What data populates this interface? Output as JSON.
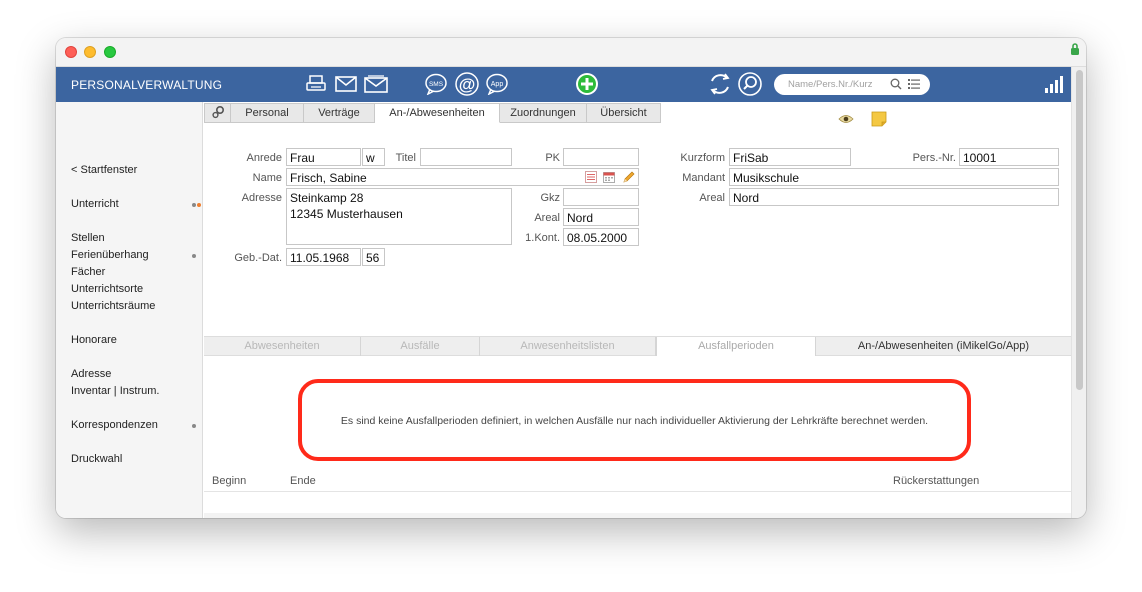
{
  "app": {
    "title": "PERSONALVERWALTUNG"
  },
  "toolbar": {
    "icons": [
      "printer-icon",
      "mail-icon",
      "mail-open-icon",
      "sms-icon",
      "at-icon",
      "app-icon",
      "add-icon",
      "refresh-icon",
      "search-icon"
    ],
    "sms_label": "SMS",
    "at_label": "@",
    "app_label": "App",
    "search_placeholder": "Name/Pers.Nr./Kurz"
  },
  "sidebar": {
    "items": [
      {
        "label": "< Startfenster"
      },
      {
        "label": "Unterricht"
      },
      {
        "label": "Stellen"
      },
      {
        "label": "Ferienüberhang"
      },
      {
        "label": "Fächer"
      },
      {
        "label": "Unterrichtsorte"
      },
      {
        "label": "Unterrichtsräume"
      },
      {
        "label": "Honorare"
      },
      {
        "label": "Adresse"
      },
      {
        "label": "Inventar | Instrum."
      },
      {
        "label": "Korrespondenzen"
      },
      {
        "label": "Druckwahl"
      }
    ]
  },
  "tabs": [
    {
      "label": "Personal"
    },
    {
      "label": "Verträge"
    },
    {
      "label": "An-/Abwesenheiten"
    },
    {
      "label": "Zuordnungen"
    },
    {
      "label": "Übersicht"
    }
  ],
  "form": {
    "anrede": {
      "label": "Anrede",
      "value": "Frau",
      "gender": "w"
    },
    "titel": {
      "label": "Titel",
      "value": ""
    },
    "pk": {
      "label": "PK",
      "value": ""
    },
    "name": {
      "label": "Name",
      "value": "Frisch, Sabine"
    },
    "adresse": {
      "label": "Adresse",
      "line1": "Steinkamp 28",
      "line2": "12345 Musterhausen"
    },
    "gkz": {
      "label": "Gkz",
      "value": ""
    },
    "areal_left": {
      "label": "Areal",
      "value": "Nord"
    },
    "kont": {
      "label": "1.Kont.",
      "value": "08.05.2000"
    },
    "gebdat": {
      "label": "Geb.-Dat.",
      "value": "11.05.1968",
      "age": "56"
    },
    "kurzform": {
      "label": "Kurzform",
      "value": "FriSab"
    },
    "persnr": {
      "label": "Pers.-Nr.",
      "value": "10001"
    },
    "mandant": {
      "label": "Mandant",
      "value": "Musikschule"
    },
    "areal_right": {
      "label": "Areal",
      "value": "Nord"
    }
  },
  "subtabs": [
    {
      "label": "Abwesenheiten"
    },
    {
      "label": "Ausfälle"
    },
    {
      "label": "Anwesenheitslisten"
    },
    {
      "label": "Ausfallperioden"
    },
    {
      "label": "An-/Abwesenheiten (iMikelGo/App)"
    }
  ],
  "notice": "Es sind keine Ausfallperioden definiert, in welchen Ausfälle nur nach individueller Aktivierung der Lehrkräfte berechnet werden.",
  "table": {
    "columns": [
      "Beginn",
      "Ende",
      "Rückerstattungen"
    ]
  },
  "colors": {
    "appbar": "#3c65a0",
    "highlight": "#ff2a1a"
  }
}
